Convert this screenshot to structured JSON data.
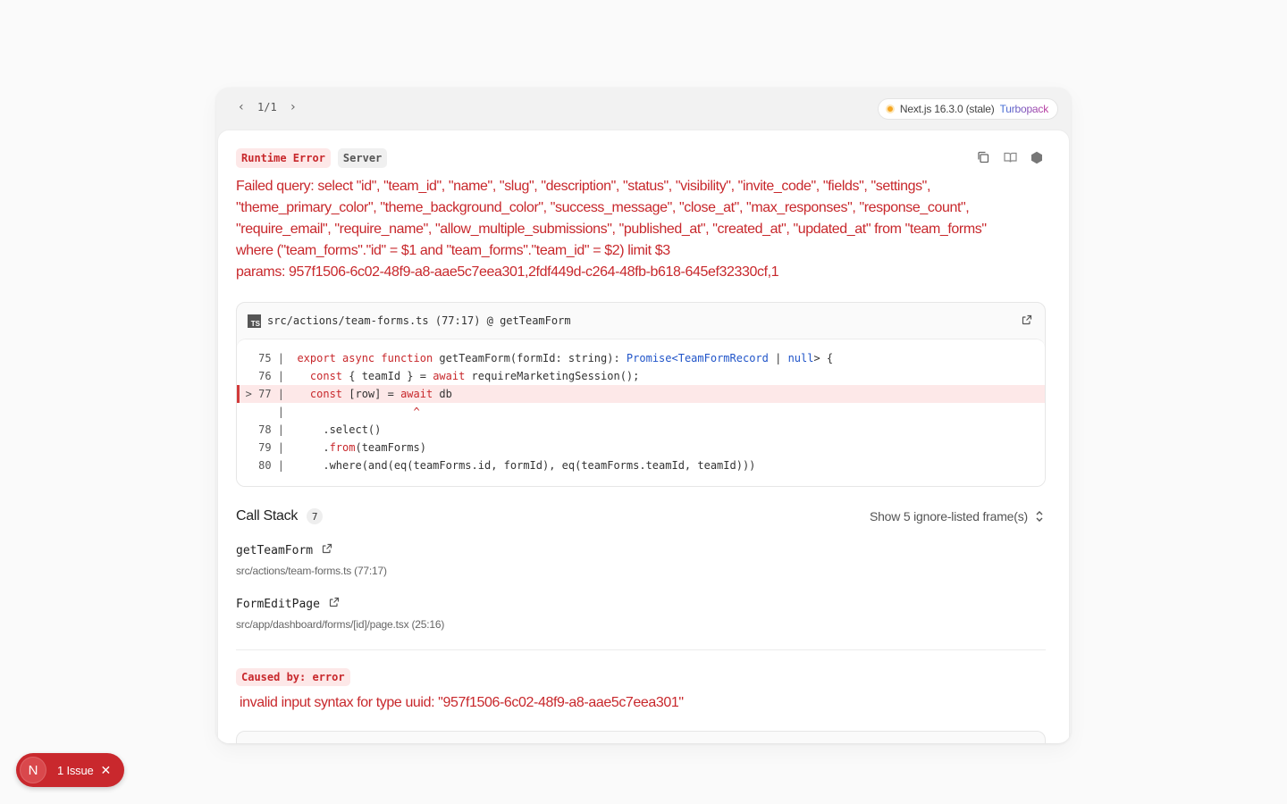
{
  "pager": {
    "prev": "‹",
    "label": "1/1",
    "next": "›"
  },
  "version": {
    "label": "Next.js 16.3.0 (stale)",
    "bundler": "Turbopack",
    "status_color": "#f5a623"
  },
  "badges": {
    "error": "Runtime Error",
    "env": "Server"
  },
  "message": {
    "line1": "Failed query: select \"id\", \"team_id\", \"name\", \"slug\", \"description\", \"status\", \"visibility\", \"invite_code\", \"fields\", \"settings\",",
    "line2": "\"theme_primary_color\", \"theme_background_color\", \"success_message\", \"close_at\", \"max_responses\", \"response_count\",",
    "line3": "\"require_email\", \"require_name\", \"allow_multiple_submissions\", \"published_at\", \"created_at\", \"updated_at\" from \"team_forms\"",
    "line4": "where (\"team_forms\".\"id\" = $1 and \"team_forms\".\"team_id\" = $2) limit $3",
    "line5": "params: 957f1506-6c02-48f9-a8-aae5c7eea301,2fdf449d-c264-48fb-b618-645ef32330cf,1"
  },
  "code": {
    "file_label": "src/actions/team-forms.ts (77:17) @ getTeamForm",
    "ts_icon": "TS",
    "lines": [
      {
        "num": "75 |",
        "a": "export async function",
        "b": " getTeamForm(formId: string): ",
        "c": "Promise<",
        "d": "TeamFormRecord",
        "e": " | ",
        "f": "null",
        "g": "> {"
      },
      {
        "num": "76 |",
        "a": "  const",
        "b": " { teamId } = ",
        "c": "await",
        "d": " requireMarketingSession();"
      },
      {
        "num": "> 77 |",
        "a": "  const",
        "b": " [row] = ",
        "c": "await",
        "d": " db"
      },
      {
        "num": "|",
        "caret": "                  ^"
      },
      {
        "num": "78 |",
        "a": "    .select()"
      },
      {
        "num": "79 |",
        "a": "    .",
        "b": "from",
        "c": "(teamForms)"
      },
      {
        "num": "80 |",
        "a": "    .where(and(eq(teamForms.id, formId), eq(teamForms.teamId, teamId)))"
      }
    ]
  },
  "call_stack": {
    "title": "Call Stack",
    "count": "7",
    "ignore_label": "Show 5 ignore-listed frame(s)",
    "frames": [
      {
        "name": "getTeamForm",
        "location": "src/actions/team-forms.ts (77:17)"
      },
      {
        "name": "FormEditPage",
        "location": "src/app/dashboard/forms/[id]/page.tsx (25:16)"
      }
    ]
  },
  "cause": {
    "label": "Caused by: error",
    "message": "invalid input syntax for type uuid: \"957f1506-6c02-48f9-a8-aae5c7eea301\""
  },
  "issues": {
    "avatar": "N",
    "label": "1 Issue",
    "close": "✕"
  },
  "colors": {
    "error": "#c8282c",
    "error_bg": "#fde8e8",
    "type": "#2155c9"
  }
}
